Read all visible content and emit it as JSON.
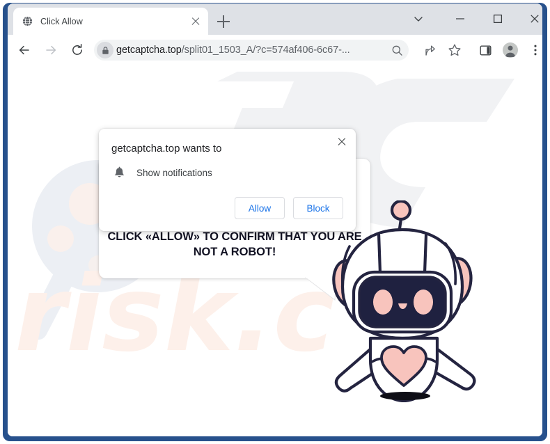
{
  "window": {
    "controls": {
      "tab_search": "tab-search",
      "minimize": "minimize",
      "maximize": "maximize",
      "close": "close"
    },
    "frame_color": "#27518c"
  },
  "tab_strip": {
    "tabs": [
      {
        "title": "Click Allow",
        "favicon": "globe-icon",
        "active": true
      }
    ],
    "new_tab_label": "+"
  },
  "toolbar": {
    "back": "back-arrow-icon",
    "forward": "forward-arrow-icon",
    "reload": "reload-icon",
    "omnibox": {
      "lock_icon": "lock-icon",
      "url_domain": "getcaptcha.top",
      "url_path": "/split01_1503_A/?c=574af406-6c67-...",
      "zoom_icon": "search-zoom-icon"
    },
    "icons": [
      "share-icon",
      "bookmark-star-icon",
      "side-panel-icon",
      "profile-avatar-icon",
      "three-dot-menu-icon"
    ]
  },
  "permission_dialog": {
    "title": "getcaptcha.top wants to",
    "permission_icon": "bell-icon",
    "permission_label": "Show notifications",
    "allow_label": "Allow",
    "block_label": "Block",
    "close_label": "close-icon",
    "accent_color": "#1a73e8"
  },
  "page": {
    "bubble_text": "CLICK «ALLOW» TO CONFIRM THAT YOU ARE NOT A ROBOT!",
    "mascot": "robot-mascot",
    "watermarks": {
      "magnifier": "magnifier-watermark",
      "letters": "pc-letters-watermark",
      "text": "risk.c"
    },
    "colors": {
      "robot_outline": "#242440",
      "robot_accent": "#f8c4bd",
      "robot_face": "#1f2140",
      "watermark_pink": "#fdf0ea",
      "watermark_gray": "#f1f2f4"
    }
  }
}
